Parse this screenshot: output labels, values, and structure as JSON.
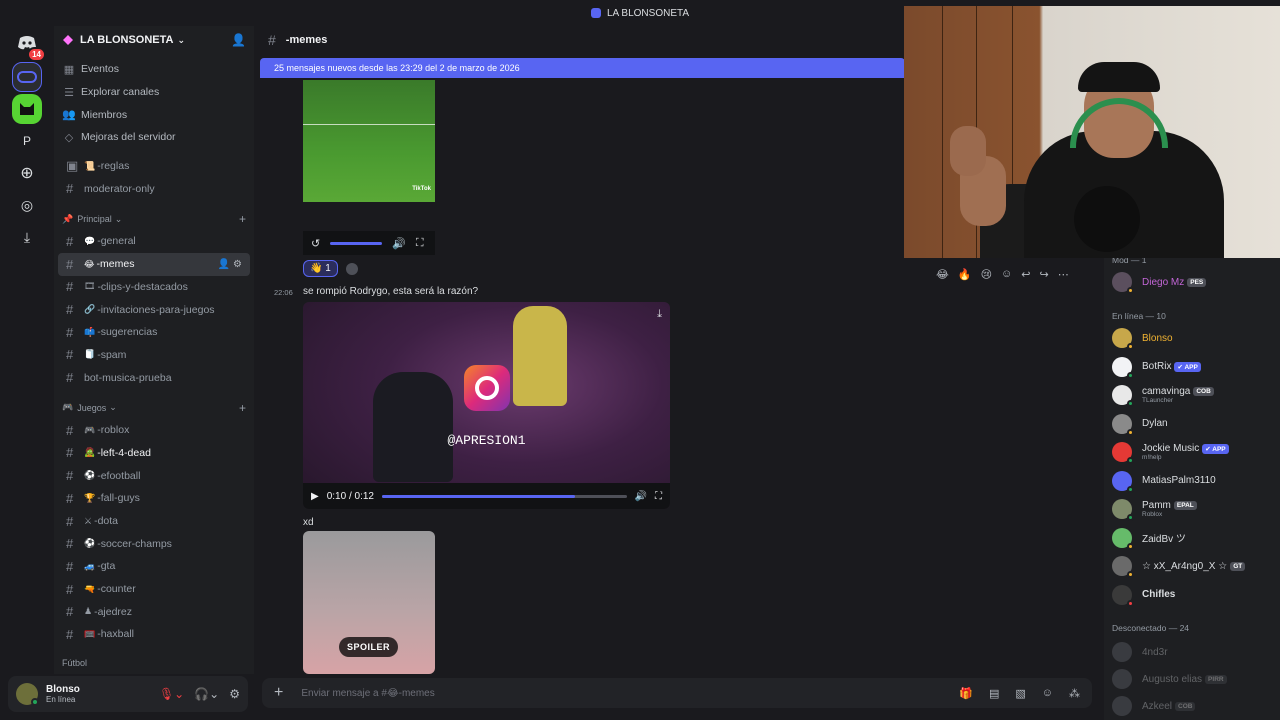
{
  "window": {
    "title": "LA BLONSONETA"
  },
  "rail": {
    "dm_badge": "14",
    "server_letter": "P"
  },
  "sidebar": {
    "server_name": "LA BLONSONETA",
    "nav": [
      {
        "label": "Eventos",
        "icon": "calendar-icon"
      },
      {
        "label": "Explorar canales",
        "icon": "browse-icon"
      },
      {
        "label": "Miembros",
        "icon": "members-icon"
      },
      {
        "label": "Mejoras del servidor",
        "icon": "boost-icon"
      }
    ],
    "top_channels": [
      {
        "label": "-reglas",
        "emoji": "📜"
      },
      {
        "label": "moderator-only",
        "emoji": ""
      }
    ],
    "cat_principal": "Principal",
    "principal": [
      {
        "label": "-general",
        "emoji": "💬"
      },
      {
        "label": "-memes",
        "emoji": "😂"
      },
      {
        "label": "-clips-y-destacados",
        "emoji": "🎞"
      },
      {
        "label": "-invitaciones-para-juegos",
        "emoji": "🔗"
      },
      {
        "label": "-sugerencias",
        "emoji": "📫"
      },
      {
        "label": "-spam",
        "emoji": "🧻"
      },
      {
        "label": "bot-musica-prueba",
        "emoji": ""
      }
    ],
    "cat_juegos": "Juegos",
    "juegos": [
      {
        "label": "-roblox",
        "emoji": "🎮"
      },
      {
        "label": "-left-4-dead",
        "emoji": "🧟"
      },
      {
        "label": "-efootball",
        "emoji": "⚽"
      },
      {
        "label": "-fall-guys",
        "emoji": "🏆"
      },
      {
        "label": "-dota",
        "emoji": "⚔"
      },
      {
        "label": "-soccer-champs",
        "emoji": "⚽"
      },
      {
        "label": "-gta",
        "emoji": "🚙"
      },
      {
        "label": "-counter",
        "emoji": "🔫"
      },
      {
        "label": "-ajedrez",
        "emoji": "♟"
      },
      {
        "label": "-haxball",
        "emoji": "🥅"
      }
    ],
    "cat_futbol": "Fútbol"
  },
  "user": {
    "name": "Blonso",
    "status": "En línea"
  },
  "chat": {
    "channel_name": "-memes",
    "new_messages": "25 mensajes nuevos desde las 23:29 del 2 de marzo de 2026",
    "tiktok_mark": "TikTok",
    "reaction_count": "1",
    "message_time": "22:06",
    "message_text": "se rompió Rodrygo, esta será la razón?",
    "video_watermark": "@APRESION1",
    "video_time": "0:10 / 0:12",
    "video_progress": 0.79,
    "xd_text": "xd",
    "spoiler_label": "SPOILER",
    "composer_placeholder": "Enviar mensaje a #😂-memes"
  },
  "members": {
    "mod_header": "Mod — 1",
    "mod": {
      "name": "Diego Mz",
      "tag": "PES",
      "color": "#c266d6"
    },
    "online_header": "En línea — 10",
    "online": [
      {
        "name": "Blonso",
        "sub": "",
        "tag": "",
        "color": "#f0b232"
      },
      {
        "name": "BotRix",
        "sub": "",
        "tag": "✔ APP",
        "color": "#dbdee1"
      },
      {
        "name": "camavinga",
        "sub": "TLauncher",
        "tag": "COB",
        "color": "#dbdee1"
      },
      {
        "name": "Dylan",
        "sub": "",
        "tag": "",
        "color": "#dbdee1"
      },
      {
        "name": "Jockie Music",
        "sub": "m!help",
        "tag": "✔ APP",
        "color": "#dbdee1"
      },
      {
        "name": "MatiasPalm3110",
        "sub": "",
        "tag": "",
        "color": "#dbdee1"
      },
      {
        "name": "Pamm",
        "sub": "Roblox",
        "tag": "EPAL",
        "color": "#dbdee1"
      },
      {
        "name": "ZaidBv ツ",
        "sub": "",
        "tag": "",
        "color": "#dbdee1"
      },
      {
        "name": "☆ xX_Ar4ng0_X ☆",
        "sub": "",
        "tag": "GT",
        "color": "#dbdee1"
      },
      {
        "name": "Chifles",
        "sub": "",
        "tag": "",
        "color": "#dbdee1"
      }
    ],
    "offline_header": "Desconectado — 24",
    "offline": [
      {
        "name": "4nd3r",
        "tag": ""
      },
      {
        "name": "Augusto elias",
        "tag": "PIRR"
      },
      {
        "name": "Azkeel",
        "tag": "COB"
      }
    ]
  },
  "colors": {
    "accent": "#5865f2",
    "online": "#23a55a",
    "idle": "#f0b232",
    "dnd": "#f23f43"
  }
}
